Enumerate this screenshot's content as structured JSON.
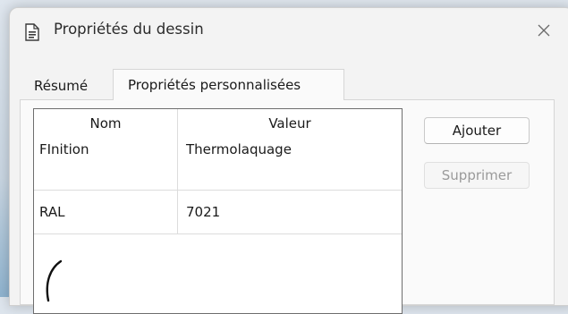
{
  "window": {
    "title": "Propriétés du dessin",
    "icon": "document-properties-icon",
    "close_icon": "close-icon"
  },
  "tabs": [
    {
      "label": "Résumé",
      "active": false
    },
    {
      "label": "Propriétés personnalisées",
      "active": true
    }
  ],
  "grid": {
    "columns": [
      "Nom",
      "Valeur"
    ],
    "rows": [
      {
        "name": "FInition",
        "value": "Thermolaquage"
      },
      {
        "name": "RAL",
        "value": "7021"
      }
    ]
  },
  "buttons": {
    "add_label": "Ajouter",
    "delete_label": "Supprimer",
    "delete_enabled": false
  },
  "colors": {
    "dialog_bg": "#f3f3f3",
    "panel_bg": "#fafafa",
    "disabled_text": "#9a9a9a"
  }
}
